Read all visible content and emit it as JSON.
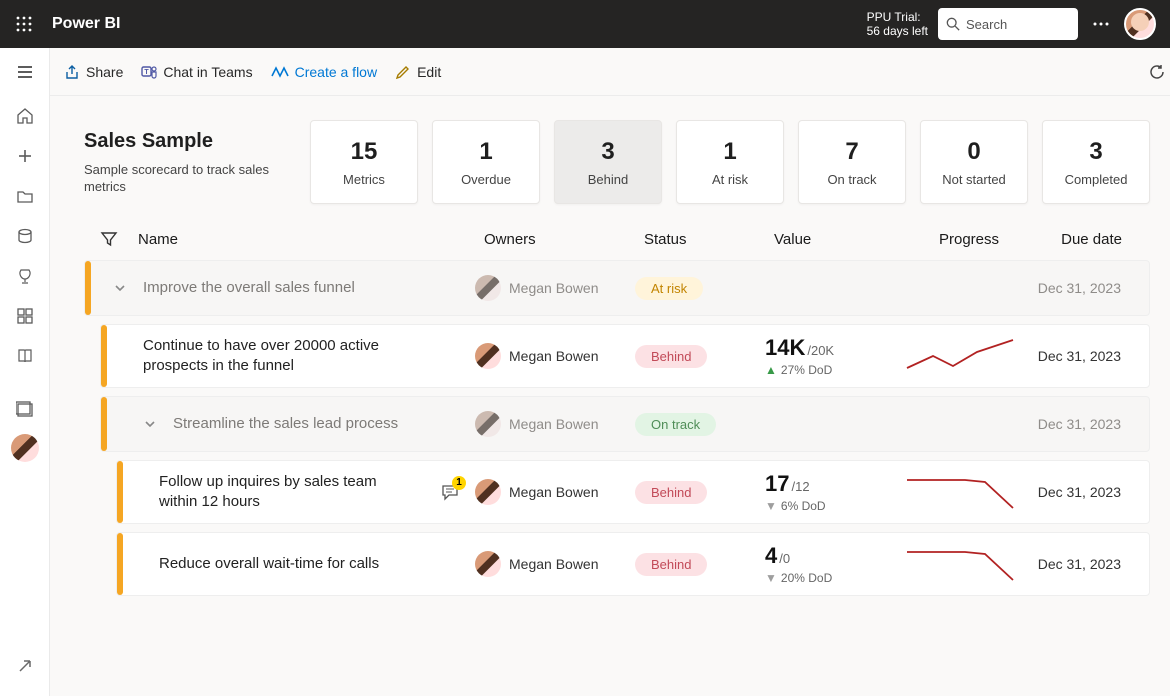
{
  "header": {
    "brand": "Power BI",
    "trial_line1": "PPU Trial:",
    "trial_line2": "56 days left",
    "search_placeholder": "Search"
  },
  "cmdbar": {
    "share": "Share",
    "chat": "Chat in Teams",
    "flow": "Create a flow",
    "edit": "Edit"
  },
  "scorecard": {
    "title": "Sales Sample",
    "subtitle": "Sample scorecard to track sales metrics",
    "summary": [
      {
        "value": "15",
        "label": "Metrics",
        "active": false
      },
      {
        "value": "1",
        "label": "Overdue",
        "active": false
      },
      {
        "value": "3",
        "label": "Behind",
        "active": true
      },
      {
        "value": "1",
        "label": "At risk",
        "active": false
      },
      {
        "value": "7",
        "label": "On track",
        "active": false
      },
      {
        "value": "0",
        "label": "Not started",
        "active": false
      },
      {
        "value": "3",
        "label": "Completed",
        "active": false
      }
    ]
  },
  "columns": {
    "name": "Name",
    "owners": "Owners",
    "status": "Status",
    "value": "Value",
    "progress": "Progress",
    "due": "Due date"
  },
  "rows": [
    {
      "kind": "parent",
      "indent": 0,
      "name": "Improve the overall sales funnel",
      "owner": "Megan Bowen",
      "status": "At risk",
      "status_class": "atrisk",
      "due": "Dec 31, 2023"
    },
    {
      "kind": "child",
      "indent": 1,
      "name": "Continue to have over 20000 active prospects in the funnel",
      "owner": "Megan Bowen",
      "status": "Behind",
      "status_class": "behind",
      "value_main": "14K",
      "value_target": "/20K",
      "delta_dir": "up",
      "delta_text": "27% DoD",
      "spark": "up",
      "due": "Dec 31, 2023"
    },
    {
      "kind": "parent",
      "indent": 1,
      "name": "Streamline the sales lead process",
      "owner": "Megan Bowen",
      "status": "On track",
      "status_class": "ontrack",
      "due": "Dec 31, 2023"
    },
    {
      "kind": "child",
      "indent": 2,
      "name": "Follow up inquires by sales team within 12 hours",
      "owner": "Megan Bowen",
      "note_count": "1",
      "status": "Behind",
      "status_class": "behind",
      "value_main": "17",
      "value_target": "/12",
      "delta_dir": "down",
      "delta_text": "6% DoD",
      "spark": "down",
      "due": "Dec 31, 2023"
    },
    {
      "kind": "child",
      "indent": 2,
      "name": "Reduce overall wait-time for calls",
      "owner": "Megan Bowen",
      "status": "Behind",
      "status_class": "behind",
      "value_main": "4",
      "value_target": "/0",
      "delta_dir": "down",
      "delta_text": "20% DoD",
      "spark": "down",
      "due": "Dec 31, 2023"
    }
  ]
}
